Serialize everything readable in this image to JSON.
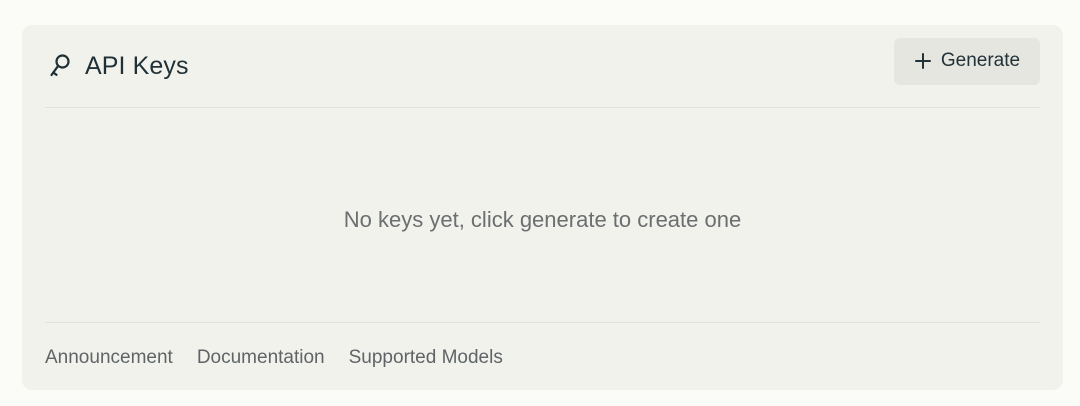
{
  "header": {
    "title": "API Keys",
    "title_icon": "key-icon",
    "generate_button": {
      "label": "Generate",
      "icon": "plus-icon"
    }
  },
  "empty_state": {
    "message": "No keys yet, click generate to create one"
  },
  "footer": {
    "links": [
      {
        "label": "Announcement"
      },
      {
        "label": "Documentation"
      },
      {
        "label": "Supported Models"
      }
    ]
  },
  "colors": {
    "page_bg": "#fbfbf8",
    "card_bg": "#f2f2ed",
    "button_bg": "#e6e6e1",
    "title_text": "#1f3137",
    "muted_text": "#6b6f70",
    "divider": "#e2e2dc"
  }
}
